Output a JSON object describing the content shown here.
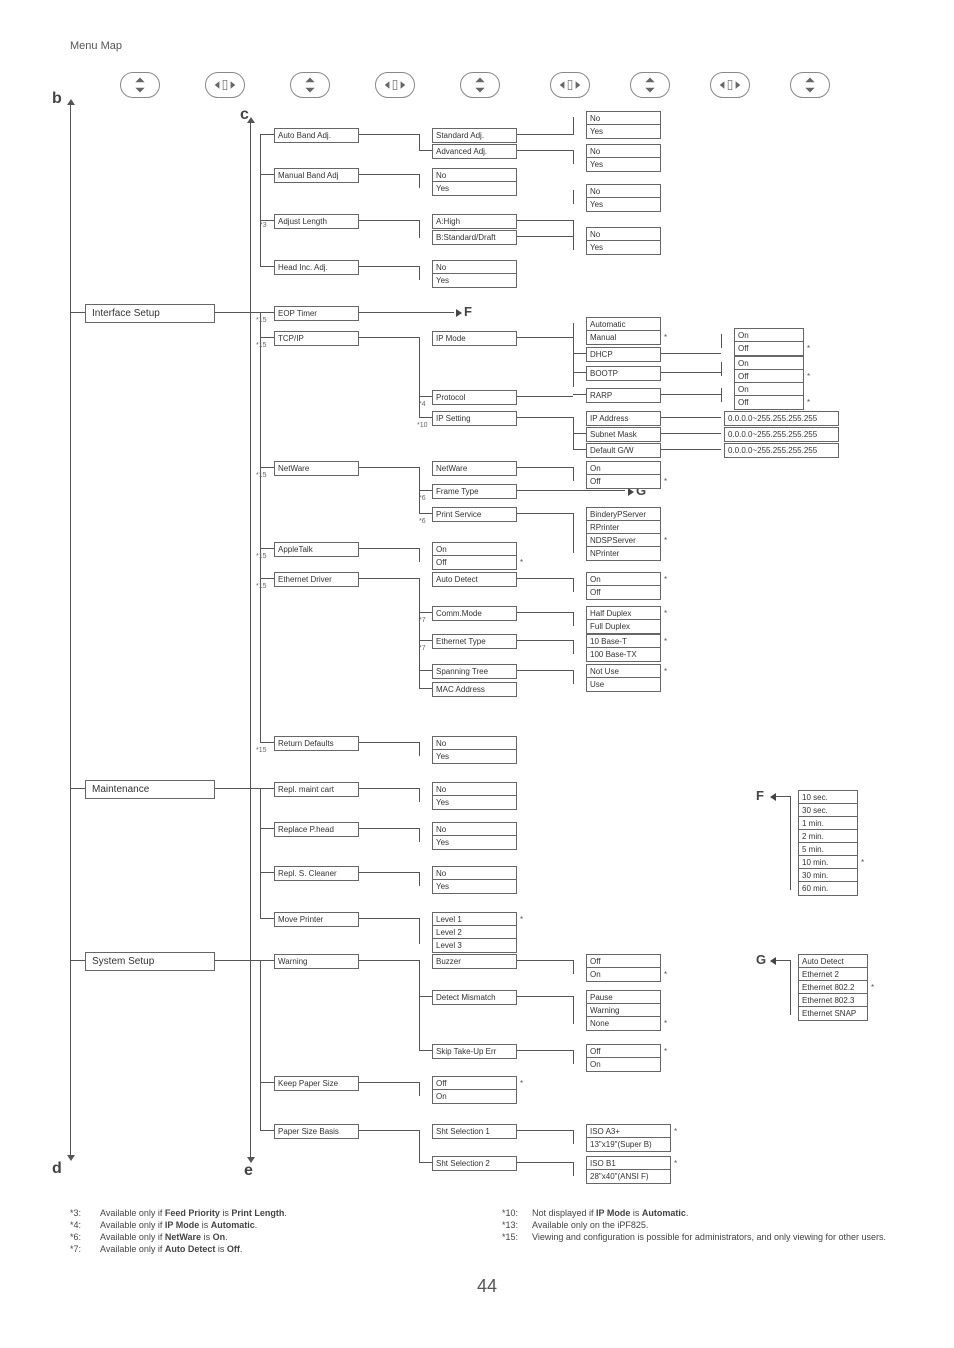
{
  "header": "Menu Map",
  "page_number": "44",
  "letters": {
    "b": "b",
    "c": "c",
    "d": "d",
    "e": "e",
    "F": "F",
    "G": "G"
  },
  "col1": {
    "interface_setup": "Interface Setup",
    "maintenance": "Maintenance",
    "system_setup": "System Setup"
  },
  "col2": {
    "auto_band": "Auto Band Adj.",
    "manual_band": "Manual Band Adj",
    "adjust_length": "Adjust Length",
    "head_inc": "Head Inc. Adj.",
    "eop_timer": "EOP Timer",
    "tcpip": "TCP/IP",
    "netware": "NetWare",
    "appletalk": "AppleTalk",
    "eth_driver": "Ethernet Driver",
    "return_defaults": "Return Defaults",
    "repl_maint": "Repl. maint cart",
    "replace_phead": "Replace P.head",
    "repl_scleaner": "Repl. S. Cleaner",
    "move_printer": "Move Printer",
    "warning": "Warning",
    "keep_paper": "Keep Paper Size",
    "paper_basis": "Paper Size Basis"
  },
  "col3": {
    "standard_adj": "Standard Adj.",
    "advanced_adj": "Advanced Adj.",
    "no": "No",
    "yes": "Yes",
    "a_high": "A:High",
    "b_standard": "B:Standard/Draft",
    "ip_mode": "IP Mode",
    "protocol": "Protocol",
    "ip_setting": "IP Setting",
    "netware": "NetWare",
    "frame_type": "Frame Type",
    "print_service": "Print Service",
    "on": "On",
    "off": "Off",
    "auto_detect": "Auto Detect",
    "comm_mode": "Comm.Mode",
    "eth_type": "Ethernet Type",
    "spanning": "Spanning Tree",
    "mac_addr": "MAC Address",
    "level1": "Level 1",
    "level2": "Level 2",
    "level3": "Level 3",
    "buzzer": "Buzzer",
    "detect_mismatch": "Detect Mismatch",
    "skip_takeup": "Skip Take-Up Err",
    "sht_sel1": "Sht Selection 1",
    "sht_sel2": "Sht Selection 2"
  },
  "col4": {
    "no": "No",
    "yes": "Yes",
    "automatic": "Automatic",
    "manual": "Manual",
    "dhcp": "DHCP",
    "bootp": "BOOTP",
    "rarp": "RARP",
    "ip_address": "IP Address",
    "subnet": "Subnet Mask",
    "default_gw": "Default G/W",
    "on": "On",
    "off": "Off",
    "bindery": "BinderyPServer",
    "rprinter": "RPrinter",
    "ndsp": "NDSPServer",
    "nprinter": "NPrinter",
    "half": "Half Duplex",
    "full": "Full Duplex",
    "ten_t": "10 Base-T",
    "hun_tx": "100 Base-TX",
    "not_use": "Not Use",
    "use": "Use",
    "pause": "Pause",
    "warning": "Warning",
    "none": "None",
    "iso_a3p": "ISO A3+",
    "sb": "13\"x19\"(Super B)",
    "iso_b1": "ISO B1",
    "ansi_f": "28\"x40\"(ANSI F)"
  },
  "col5": {
    "on": "On",
    "off": "Off",
    "ip_range": "0.0.0.0~255.255.255.255"
  },
  "f_list": {
    "t10s": "10 sec.",
    "t30s": "30 sec.",
    "t1m": "1 min.",
    "t2m": "2 min.",
    "t5m": "5 min.",
    "t10m": "10 min.",
    "t30m": "30 min.",
    "t60m": "60 min."
  },
  "g_list": {
    "auto": "Auto Detect",
    "e2": "Ethernet 2",
    "e8022": "Ethernet 802.2",
    "e8023": "Ethernet 802.3",
    "esnap": "Ethernet SNAP"
  },
  "notes": {
    "n3": "*3",
    "n4": "*4",
    "n6": "*6",
    "n7": "*7",
    "n10": "*10",
    "n13": "*13",
    "n15": "*15"
  },
  "footnotes": {
    "f3": {
      "n": "*3:",
      "t": "Available only if Feed Priority is Print Length."
    },
    "f4": {
      "n": "*4:",
      "t": "Available only if IP Mode is Automatic."
    },
    "f6": {
      "n": "*6:",
      "t": "Available only if NetWare is On."
    },
    "f7": {
      "n": "*7:",
      "t": "Available only if Auto Detect is Off."
    },
    "f10": {
      "n": "*10:",
      "t": "Not displayed if IP Mode is Automatic."
    },
    "f13": {
      "n": "*13:",
      "t": "Available only on the iPF825."
    },
    "f15": {
      "n": "*15:",
      "t": "Viewing and configuration is possible for administrators, and only viewing for other users."
    }
  }
}
